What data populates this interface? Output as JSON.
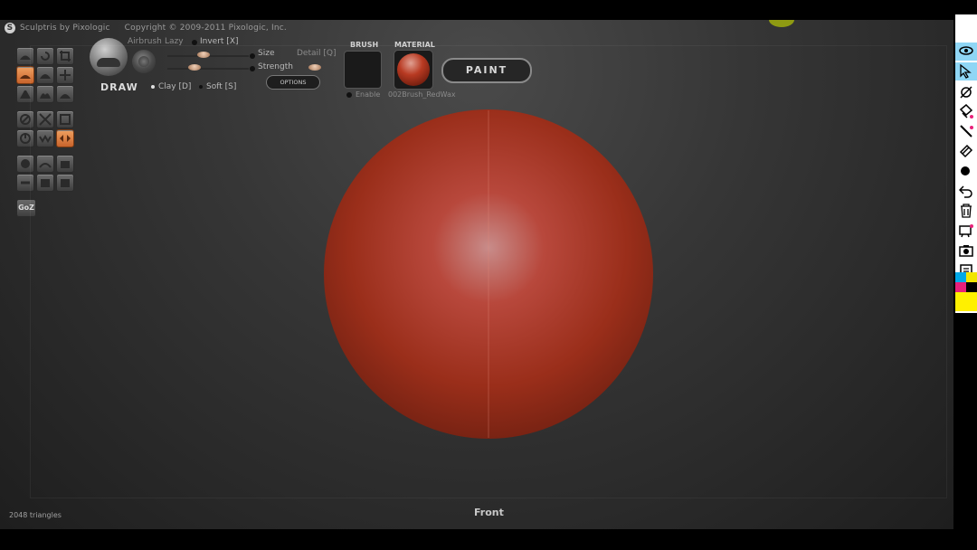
{
  "title_bar": {
    "app_name": "Sculptris by Pixologic",
    "copyright": "Copyright © 2009-2011 Pixologic, Inc."
  },
  "tool_panel": {
    "airbrush_label": "Airbrush",
    "lazy_label": "Lazy",
    "invert_label": "Invert [X]",
    "size_label": "Size",
    "strength_label": "Strength",
    "detail_label": "Detail [Q]",
    "tool_name": "DRAW",
    "clay_label": "Clay [D]",
    "soft_label": "Soft [S]",
    "options_label": "OPTIONS",
    "goz_label": "GoZ"
  },
  "brush": {
    "header": "BRUSH",
    "enable_label": "Enable"
  },
  "material": {
    "header": "MATERIAL",
    "name": "002Brush_RedWax"
  },
  "paint_button": "PAINT",
  "status": {
    "triangles": "2048 triangles",
    "view": "Front"
  },
  "colors": {
    "sphere": "#9a2e1a",
    "active_tool": "#e08040",
    "right_bar_selected": "#8fd6f5"
  },
  "right_toolbar_icons": [
    "eye-icon",
    "pointer-icon",
    "symmetry-icon",
    "brush-settings-icon",
    "line-icon",
    "eraser-icon",
    "dot-icon",
    "undo-icon",
    "trash-icon",
    "stencil-icon",
    "camera-icon",
    "clipboard-icon",
    "color-palette-icon"
  ]
}
